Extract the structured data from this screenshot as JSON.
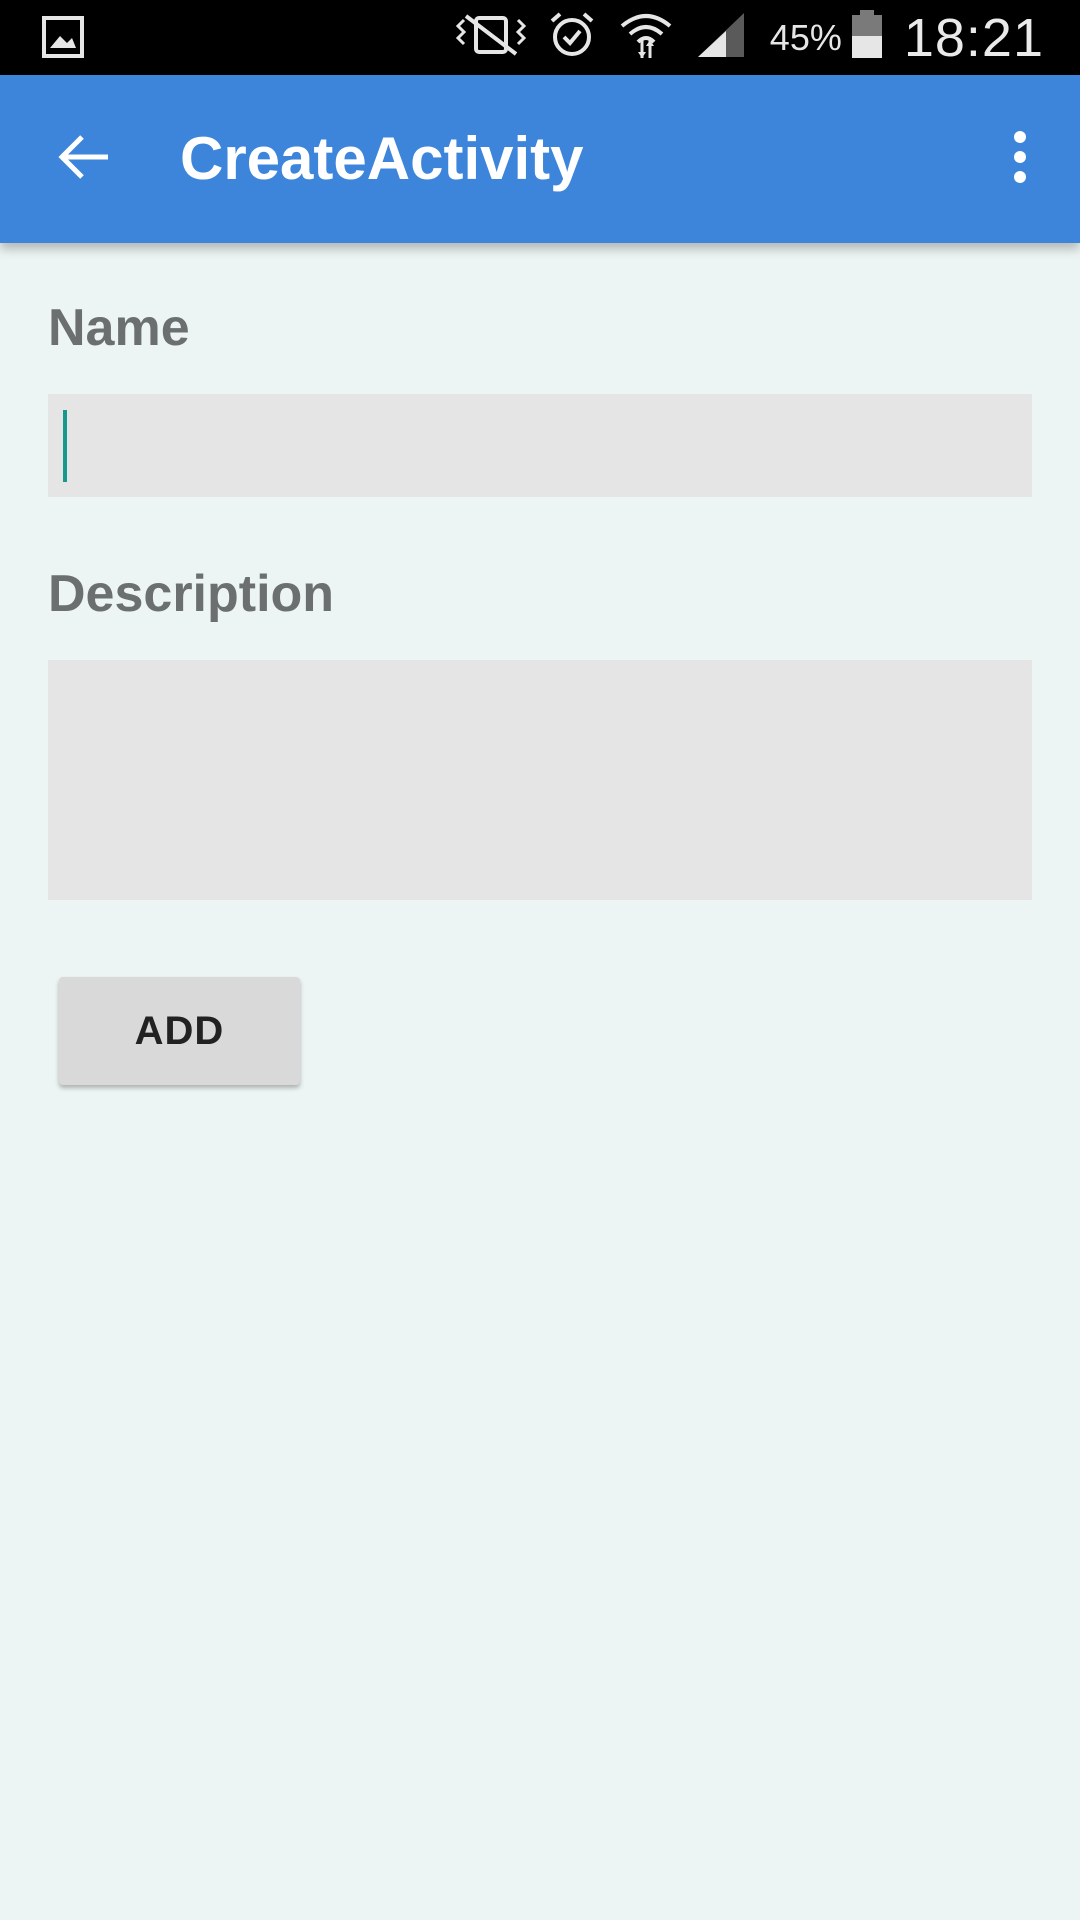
{
  "status_bar": {
    "battery_percent": "45%",
    "clock": "18:21",
    "icons": [
      "gallery-icon",
      "vibrate-icon",
      "alarm-icon",
      "wifi-icon",
      "signal-icon",
      "battery-icon"
    ]
  },
  "app_bar": {
    "title": "CreateActivity",
    "back_icon": "arrow-back-icon",
    "overflow_icon": "more-vert-icon",
    "background_color": "#3d85db"
  },
  "form": {
    "name_label": "Name",
    "name_value": "",
    "description_label": "Description",
    "description_value": "",
    "add_button_label": "ADD",
    "cursor_color": "#14998a"
  }
}
